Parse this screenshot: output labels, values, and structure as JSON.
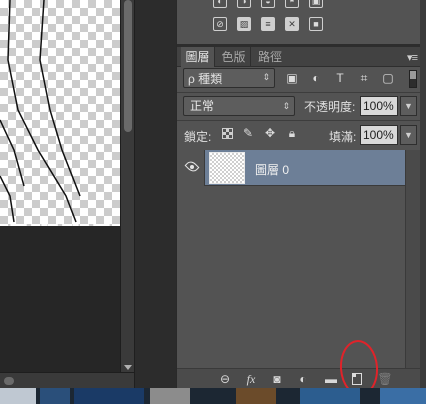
{
  "tabs": {
    "layers": "圖層",
    "channels": "色版",
    "paths": "路徑"
  },
  "filter": {
    "kind_label": "ρ 種類",
    "icons": [
      "image-filter-icon",
      "adjustment-filter-icon",
      "type-filter-icon",
      "shape-filter-icon",
      "smart-object-filter-icon"
    ],
    "type_glyph": "T"
  },
  "blend": {
    "mode": "正常",
    "opacity_label": "不透明度:",
    "opacity_value": "100%"
  },
  "lock": {
    "label": "鎖定:",
    "fill_label": "填滿:",
    "fill_value": "100%"
  },
  "layers": [
    {
      "name": "圖層 0",
      "visible": true,
      "selected": true
    }
  ],
  "bottom_bar": {
    "fx_label": "fx"
  },
  "colors": {
    "panel": "#535353",
    "selected_row": "#6d7f97",
    "annotation": "#e0232a"
  }
}
